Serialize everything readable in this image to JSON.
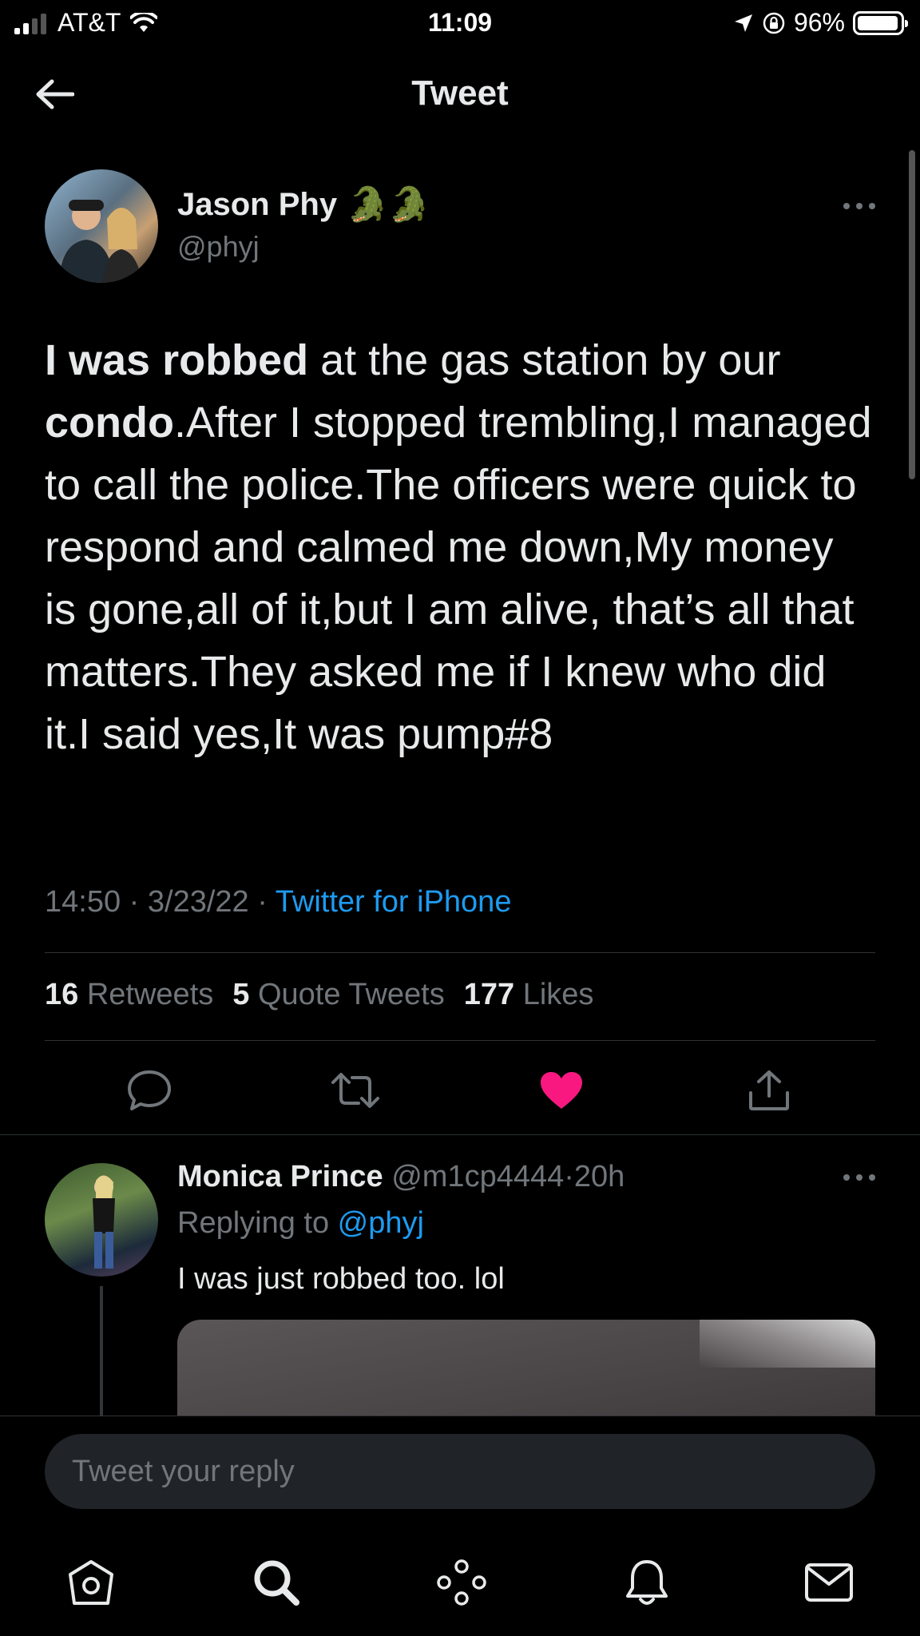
{
  "status_bar": {
    "carrier": "AT&T",
    "time": "11:09",
    "battery_pct": "96%",
    "battery_level": 0.96
  },
  "header": {
    "title": "Tweet"
  },
  "tweet": {
    "author_name": "Jason Phy",
    "author_emoji": "🐊🐊",
    "author_handle": "@phyj",
    "text_bold_1": "I was robbed",
    "text_1": " at the gas station by our ",
    "text_bold_2": "condo",
    "text_2": ".After I stopped trembling,I managed to call the police.The officers were quick to respond and calmed me down,My money is gone,all of it,but I am alive, that’s all that matters.They asked me if I knew who did it.I said yes,It was pump#8",
    "time": "14:50",
    "date": "3/23/22",
    "source": "Twitter for iPhone",
    "separator": " · ",
    "retweets_count": "16",
    "retweets_label": "Retweets",
    "quotes_count": "5",
    "quotes_label": "Quote Tweets",
    "likes_count": "177",
    "likes_label": "Likes",
    "liked": true
  },
  "reply": {
    "author_name": "Monica Prince",
    "author_handle": "@m1cp4444",
    "age": "20h",
    "replying_prefix": "Replying to ",
    "replying_to": "@phyj",
    "text": "I was just robbed too. lol"
  },
  "composer": {
    "placeholder": "Tweet your reply"
  },
  "colors": {
    "background": "#000000",
    "accent": "#1d9bf0",
    "like": "#f91880",
    "muted": "#71767b"
  },
  "tabbar": [
    "home-icon",
    "search-icon",
    "spaces-icon",
    "notifications-icon",
    "messages-icon"
  ]
}
